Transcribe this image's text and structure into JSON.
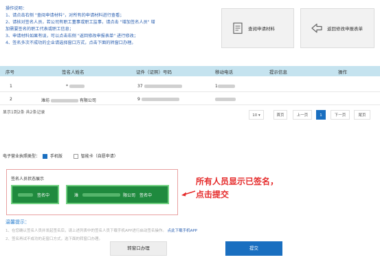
{
  "instructions": {
    "title": "操作说明：",
    "lines": [
      "1、请点击右侧 \"查阅申请材料\"，对所有的申请材料进行查看；",
      "2、请核对签名人员，若公司有职工董事或职工监事，请点击 \"增加签名人员\" 增",
      "加需要签名的职工代表或职工信息；",
      "3、申请材料如果有误，可以点击右侧 \"返回修改申报表单\" 进行修改；",
      "4、签名多次不成功的企业请选择窗口方式，点击下面的转窗口办理。"
    ]
  },
  "actions": {
    "view_label": "查阅申请材料",
    "back_label": "返回修改申报表单"
  },
  "table": {
    "headers": [
      "序号",
      "签名人姓名",
      "证件（证照）号码",
      "移动电话",
      "提示信息",
      "操作"
    ],
    "rows": [
      {
        "no": "1",
        "name": "*",
        "id": "37",
        "phone": "1"
      },
      {
        "no": "2",
        "name_prefix": "潍坊",
        "name_suffix": "有限公司",
        "id": "9",
        "phone": ""
      }
    ]
  },
  "pagination": {
    "summary": "显示1到2条 共2条记录",
    "page_size": "10",
    "first": "首页",
    "prev": "上一页",
    "current": "1",
    "next": "下一页",
    "last": "尾页"
  },
  "sign_type": {
    "label": "电子营业执照类型：",
    "option_phone": "手机版",
    "option_card": "智能卡（自愿申请）"
  },
  "status": {
    "title": "签名人员状态展示",
    "card1_status": "签名中",
    "card2_prefix": "潍",
    "card2_suffix": "限公司",
    "card2_status": "签名中"
  },
  "note": {
    "line1": "所有人员显示已签名，",
    "line2": "点击提交"
  },
  "tips": {
    "title": "温馨提示：",
    "line1": "1、在您确认签名人员并发起签名后，请上述列表中的签名人员下载手机APP进行启动签名操作。",
    "link": "点此下载手机APP",
    "line2": "2、签名再试不成功的走窗口方式，选下面的转窗口办理。"
  },
  "buttons": {
    "counter": "转窗口办理",
    "submit": "提交"
  },
  "colors": {
    "accent": "#1a6fc0",
    "header_bg": "#c5e3ef",
    "sign_card": "#1f8a3e",
    "note_red": "#e52b2b"
  }
}
